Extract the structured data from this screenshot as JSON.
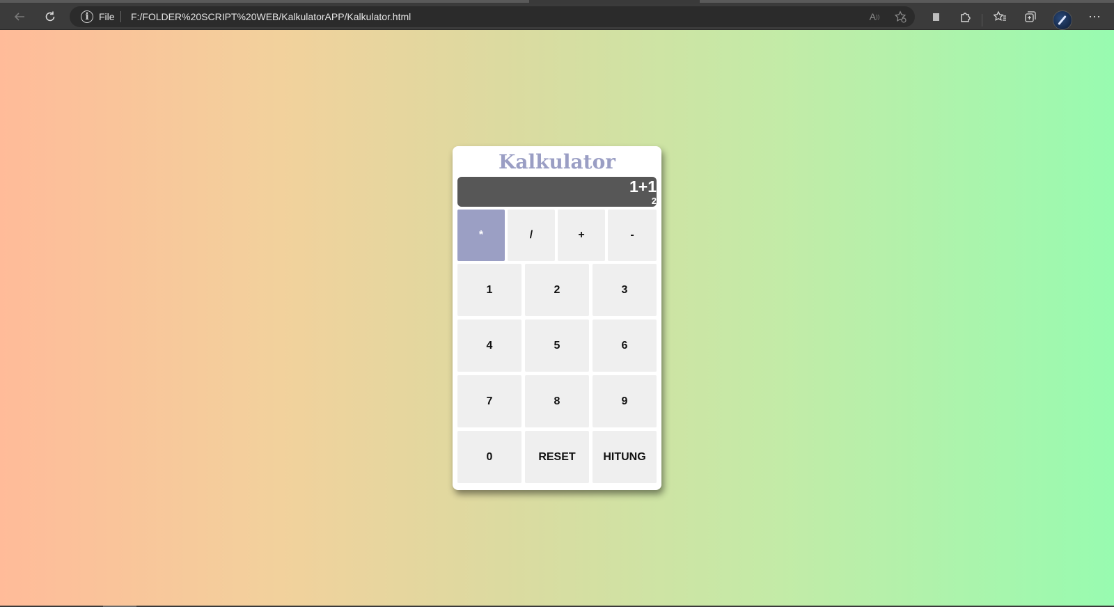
{
  "browser": {
    "address": {
      "scheme_label": "File",
      "url": "F:/FOLDER%20SCRIPT%20WEB/KalkulatorAPP/Kalkulator.html"
    },
    "icons": {
      "back": "arrow-left-icon",
      "refresh": "refresh-icon",
      "info": "info-icon",
      "read_aloud": "read-aloud-icon",
      "add_favorite": "star-add-icon",
      "extension_square": "square-icon",
      "extensions": "puzzle-icon",
      "favorites": "favorites-icon",
      "collections": "collections-icon",
      "profile": "profile-avatar",
      "more": "more-icon"
    }
  },
  "colors": {
    "page_gradient_start": "#ffbb99",
    "page_gradient_end": "#98fbb0",
    "title_color": "#9a9ec4",
    "display_bg": "#575757",
    "active_button": "#9b9fc4",
    "button_bg": "#efefef"
  },
  "calculator": {
    "title": "Kalkulator",
    "display": {
      "expression": "1+1",
      "result": "2"
    },
    "operators": [
      "*",
      "/",
      "+",
      "-"
    ],
    "active_operator": "*",
    "keys": [
      "1",
      "2",
      "3",
      "4",
      "5",
      "6",
      "7",
      "8",
      "9",
      "0",
      "RESET",
      "HITUNG"
    ]
  }
}
